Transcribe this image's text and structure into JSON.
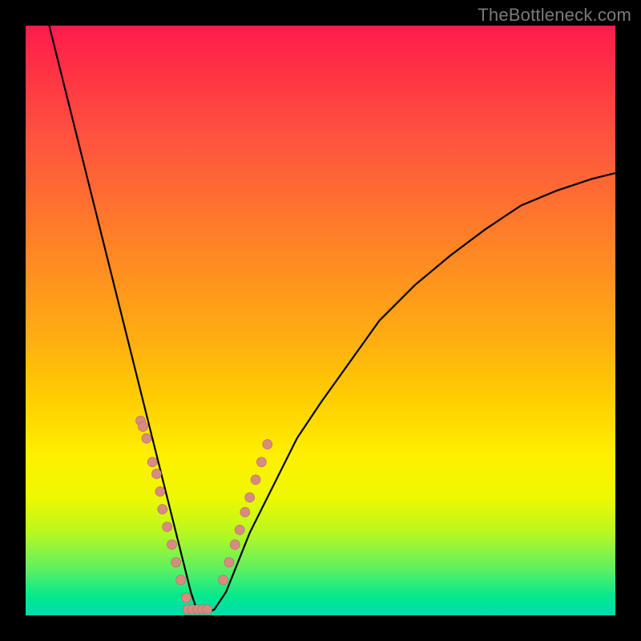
{
  "watermark": "TheBottleneck.com",
  "chart_data": {
    "type": "line",
    "title": "",
    "xlabel": "",
    "ylabel": "",
    "xlim": [
      0,
      100
    ],
    "ylim": [
      0,
      100
    ],
    "grid": false,
    "series": [
      {
        "name": "bottleneck-curve",
        "x": [
          4,
          6,
          8,
          10,
          12,
          14,
          16,
          18,
          20,
          21,
          22,
          23,
          24,
          25,
          26,
          27,
          28,
          29,
          30,
          31,
          32,
          34,
          36,
          38,
          42,
          46,
          50,
          55,
          60,
          66,
          72,
          78,
          84,
          90,
          96,
          100
        ],
        "y": [
          100,
          92,
          84,
          76,
          68,
          60,
          52,
          44,
          36,
          32,
          28,
          24,
          20,
          16,
          12,
          8,
          4,
          1,
          0.5,
          0.5,
          1,
          4,
          9,
          14,
          22,
          30,
          36,
          43,
          50,
          56,
          61,
          65.5,
          69.5,
          72,
          74,
          75
        ]
      }
    ],
    "markers": {
      "left_cluster": [
        {
          "x": 19.5,
          "y": 33
        },
        {
          "x": 19.9,
          "y": 32
        },
        {
          "x": 20.5,
          "y": 30
        },
        {
          "x": 21.5,
          "y": 26
        },
        {
          "x": 22.2,
          "y": 24
        },
        {
          "x": 22.8,
          "y": 21
        },
        {
          "x": 23.2,
          "y": 18
        },
        {
          "x": 24.0,
          "y": 15
        },
        {
          "x": 24.8,
          "y": 12
        },
        {
          "x": 25.5,
          "y": 9
        },
        {
          "x": 26.3,
          "y": 6
        },
        {
          "x": 27.2,
          "y": 3
        }
      ],
      "bottom_cluster": [
        {
          "x": 27.5,
          "y": 1
        },
        {
          "x": 28.3,
          "y": 1
        },
        {
          "x": 29.2,
          "y": 1
        },
        {
          "x": 30.0,
          "y": 1
        },
        {
          "x": 30.8,
          "y": 1
        }
      ],
      "right_cluster": [
        {
          "x": 33.5,
          "y": 6
        },
        {
          "x": 34.5,
          "y": 9
        },
        {
          "x": 35.5,
          "y": 12
        },
        {
          "x": 36.3,
          "y": 14.5
        },
        {
          "x": 37.2,
          "y": 17.5
        },
        {
          "x": 38.0,
          "y": 20
        },
        {
          "x": 39.0,
          "y": 23
        },
        {
          "x": 40.0,
          "y": 26
        },
        {
          "x": 41.0,
          "y": 29
        }
      ]
    },
    "colors": {
      "curve": "#000000",
      "markers": "#d98b82",
      "gradient_top": "#ff1a4d",
      "gradient_bottom": "#00dcb0"
    }
  }
}
